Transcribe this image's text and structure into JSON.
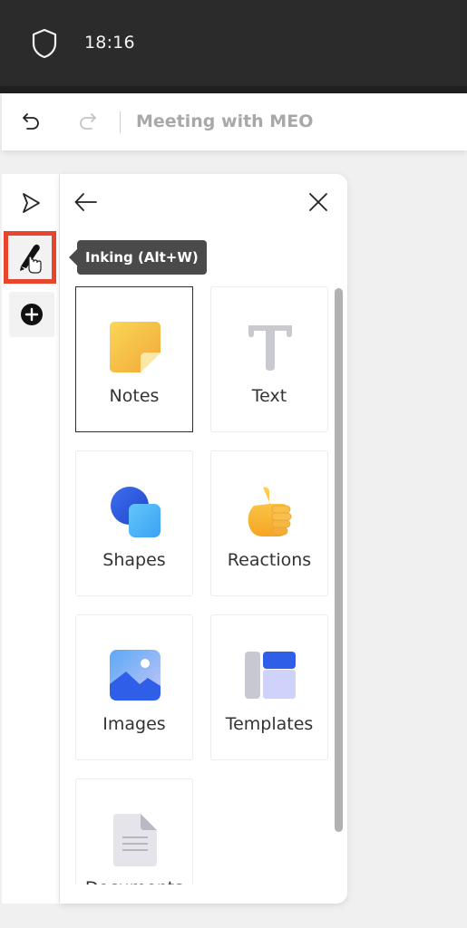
{
  "status_bar": {
    "time": "18:16",
    "security_icon": "shield-icon"
  },
  "toolbar": {
    "undo_icon": "undo-icon",
    "redo_icon": "redo-icon",
    "title": "Meeting with MEO"
  },
  "rail": {
    "items": [
      {
        "name": "select",
        "icon": "pointer-icon"
      },
      {
        "name": "inking",
        "icon": "pen-icon",
        "highlighted": true
      },
      {
        "name": "add",
        "icon": "plus-circle-icon"
      }
    ],
    "tooltip": "Inking (Alt+W)",
    "highlight_color": "#e8452c"
  },
  "panel": {
    "back_icon": "arrow-left-icon",
    "close_icon": "close-icon",
    "tiles": [
      {
        "label": "Notes",
        "icon": "sticky-note-icon",
        "selected": true
      },
      {
        "label": "Text",
        "icon": "text-icon"
      },
      {
        "label": "Shapes",
        "icon": "shapes-icon"
      },
      {
        "label": "Reactions",
        "icon": "thumbs-up-icon"
      },
      {
        "label": "Images",
        "icon": "image-icon"
      },
      {
        "label": "Templates",
        "icon": "templates-icon"
      },
      {
        "label": "Documents",
        "icon": "document-icon"
      }
    ]
  }
}
